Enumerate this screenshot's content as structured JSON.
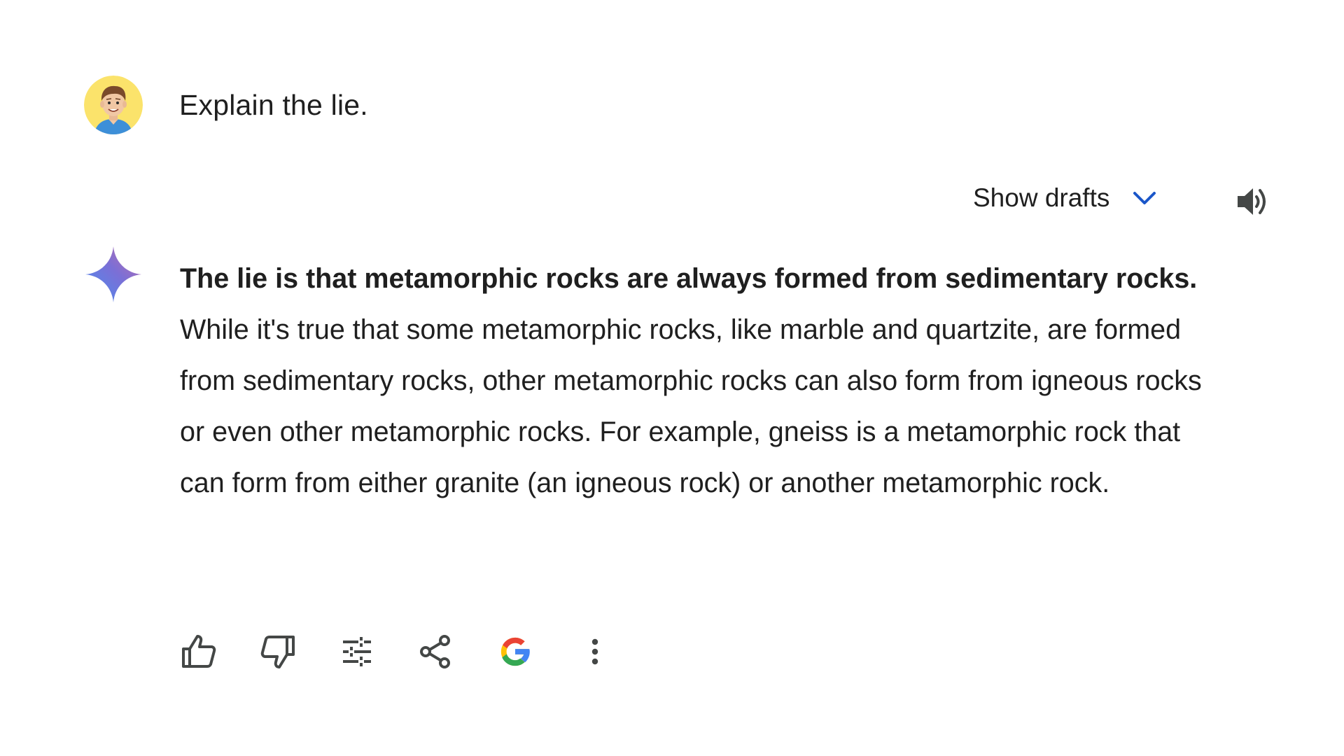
{
  "prompt": {
    "text": "Explain the lie."
  },
  "drafts": {
    "label": "Show drafts"
  },
  "response": {
    "bold_text": "The lie is that metamorphic rocks are always formed from sedimentary rocks.",
    "body_text": " While it's true that some metamorphic rocks, like marble and quartzite, are formed from sedimentary rocks, other metamorphic rocks can also form from igneous rocks or even other metamorphic rocks. For example, gneiss is a metamorphic rock that can form from either granite (an igneous rock) or another metamorphic rock."
  },
  "icons": {
    "avatar": "user-avatar",
    "sparkle": "gemini-sparkle-icon",
    "chevron": "chevron-down-icon",
    "speaker": "speaker-icon",
    "actions": [
      "thumbs-up-icon",
      "thumbs-down-icon",
      "tune-icon",
      "share-icon",
      "google-icon",
      "more-vert-icon"
    ]
  },
  "colors": {
    "chevron": "#1a56c9",
    "text": "#1f1f1f",
    "icon": "#444746",
    "avatar_bg": "#fbe36b"
  }
}
